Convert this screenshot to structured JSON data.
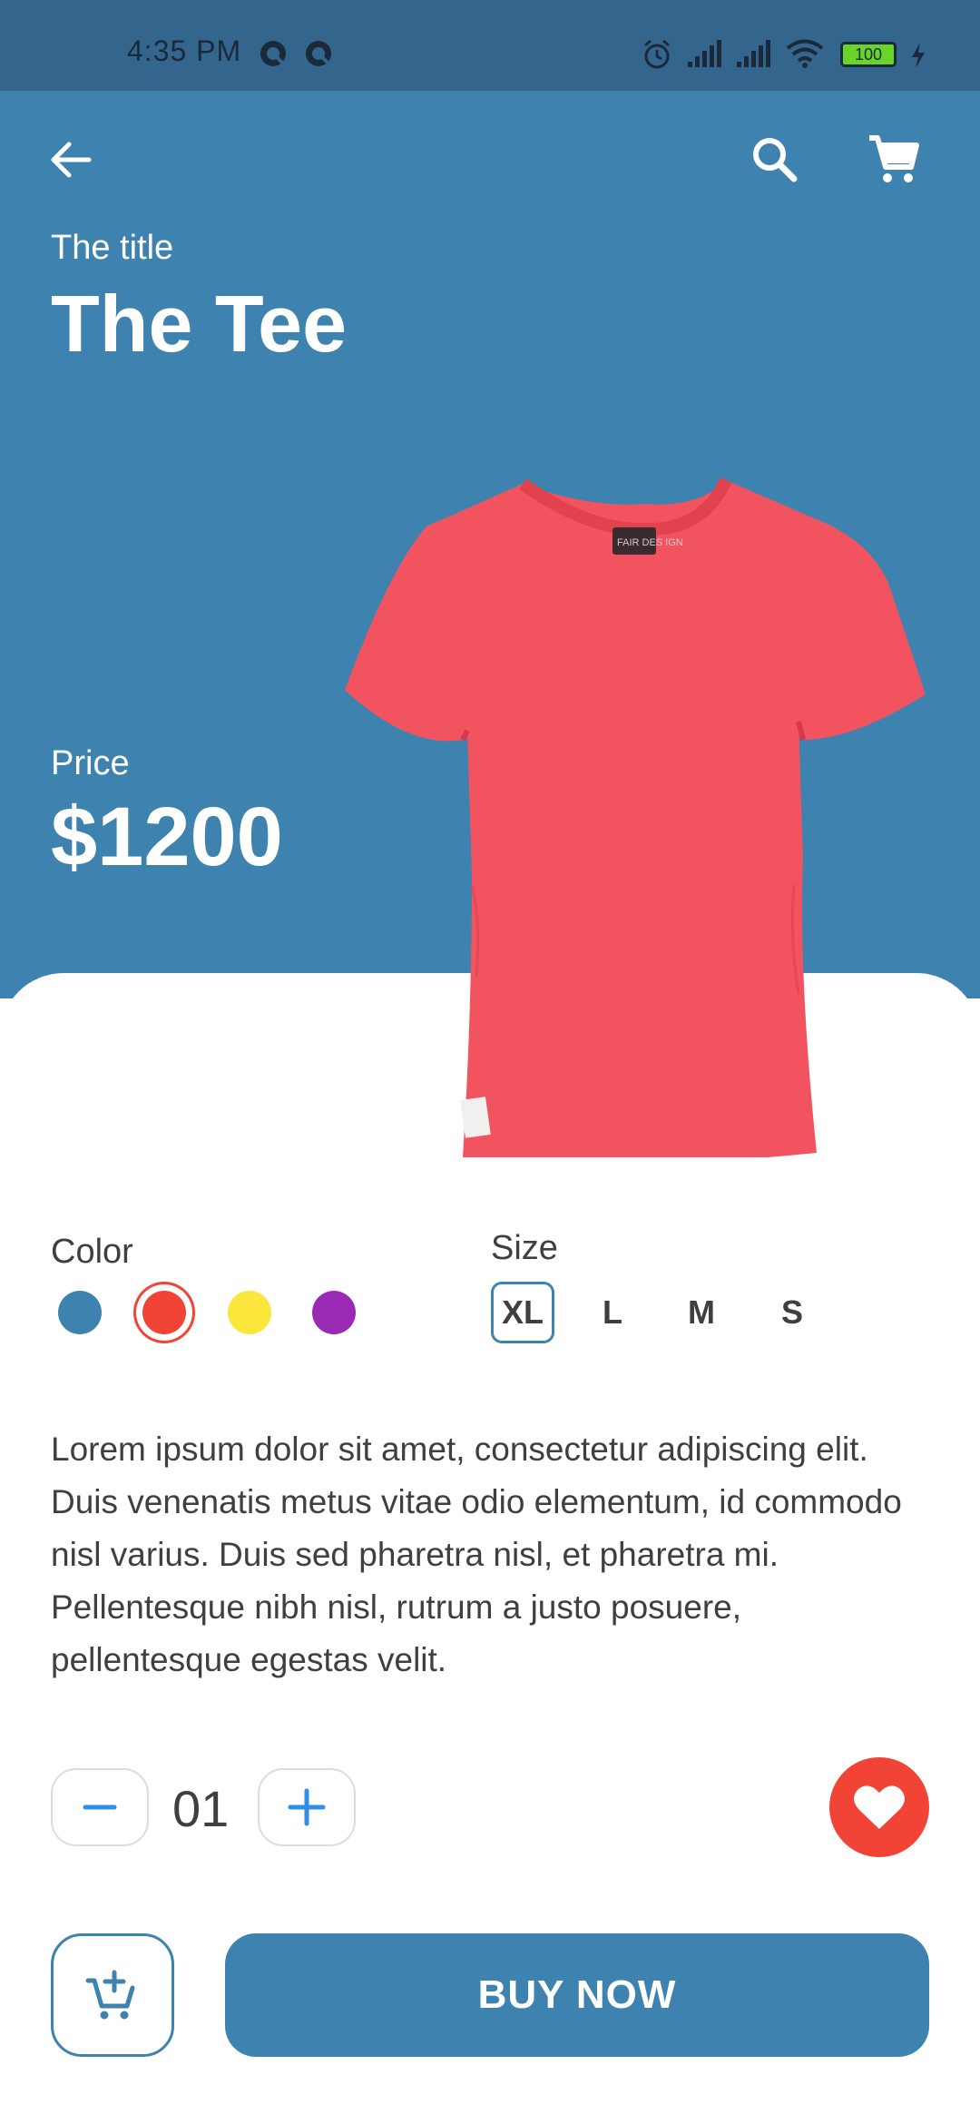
{
  "status_bar": {
    "time": "4:35 PM",
    "battery": "100"
  },
  "header": {
    "back_icon": "arrow-left-icon",
    "search_icon": "search-icon",
    "cart_icon": "shopping-cart-icon"
  },
  "product": {
    "title_label": "The title",
    "title": "The Tee",
    "price_label": "Price",
    "price": "$1200",
    "image_color": "#f2545f",
    "tag_text": "FAIR DES IGN"
  },
  "options": {
    "color_label": "Color",
    "colors": [
      "#3e82b0",
      "#f14336",
      "#fbe63c",
      "#9a2ab3"
    ],
    "selected_color_index": 1,
    "size_label": "Size",
    "sizes": [
      "XL",
      "L",
      "M",
      "S"
    ],
    "selected_size_index": 0
  },
  "description": "Lorem ipsum dolor sit amet, consectetur adipiscing elit. Duis venenatis metus vitae odio elementum, id commodo nisl varius. Duis sed pharetra nisl, et pharetra mi. Pellentesque nibh nisl, rutrum a justo posuere, pellentesque egestas velit.",
  "quantity": {
    "value": "01",
    "minus_icon": "minus-icon",
    "plus_icon": "plus-icon"
  },
  "actions": {
    "favorite_icon": "heart-icon",
    "add_to_cart_icon": "cart-plus-icon",
    "buy_label": "BUY NOW"
  },
  "colors": {
    "primary": "#3e82b0",
    "accent": "#f14336",
    "status_bar": "#33658d"
  }
}
